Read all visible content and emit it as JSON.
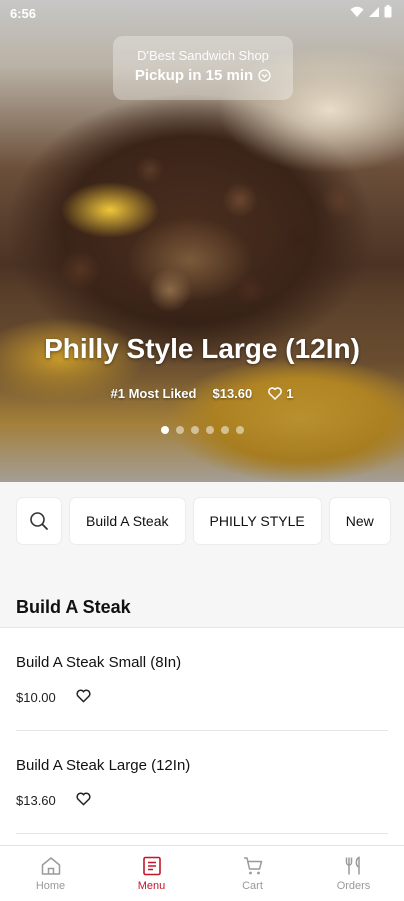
{
  "status_bar": {
    "time": "6:56"
  },
  "store": {
    "name": "D'Best Sandwich Shop",
    "pickup": "Pickup in 15 min"
  },
  "hero": {
    "title": "Philly Style Large (12In)",
    "badge": "#1 Most Liked",
    "price": "$13.60",
    "likes": "1",
    "carousel": {
      "count": 6,
      "active_index": 0
    }
  },
  "categories": [
    "Build A Steak",
    "PHILLY STYLE",
    "New"
  ],
  "section": {
    "title": "Build A Steak"
  },
  "items": [
    {
      "name": "Build A Steak Small (8In)",
      "price": "$10.00"
    },
    {
      "name": "Build A Steak Large (12In)",
      "price": "$13.60"
    }
  ],
  "nav": [
    {
      "label": "Home",
      "icon": "home-icon"
    },
    {
      "label": "Menu",
      "icon": "menu-icon",
      "active": true
    },
    {
      "label": "Cart",
      "icon": "cart-icon"
    },
    {
      "label": "Orders",
      "icon": "orders-icon"
    }
  ],
  "colors": {
    "accent": "#c0182a",
    "inactive_nav": "#9a9a9a"
  }
}
